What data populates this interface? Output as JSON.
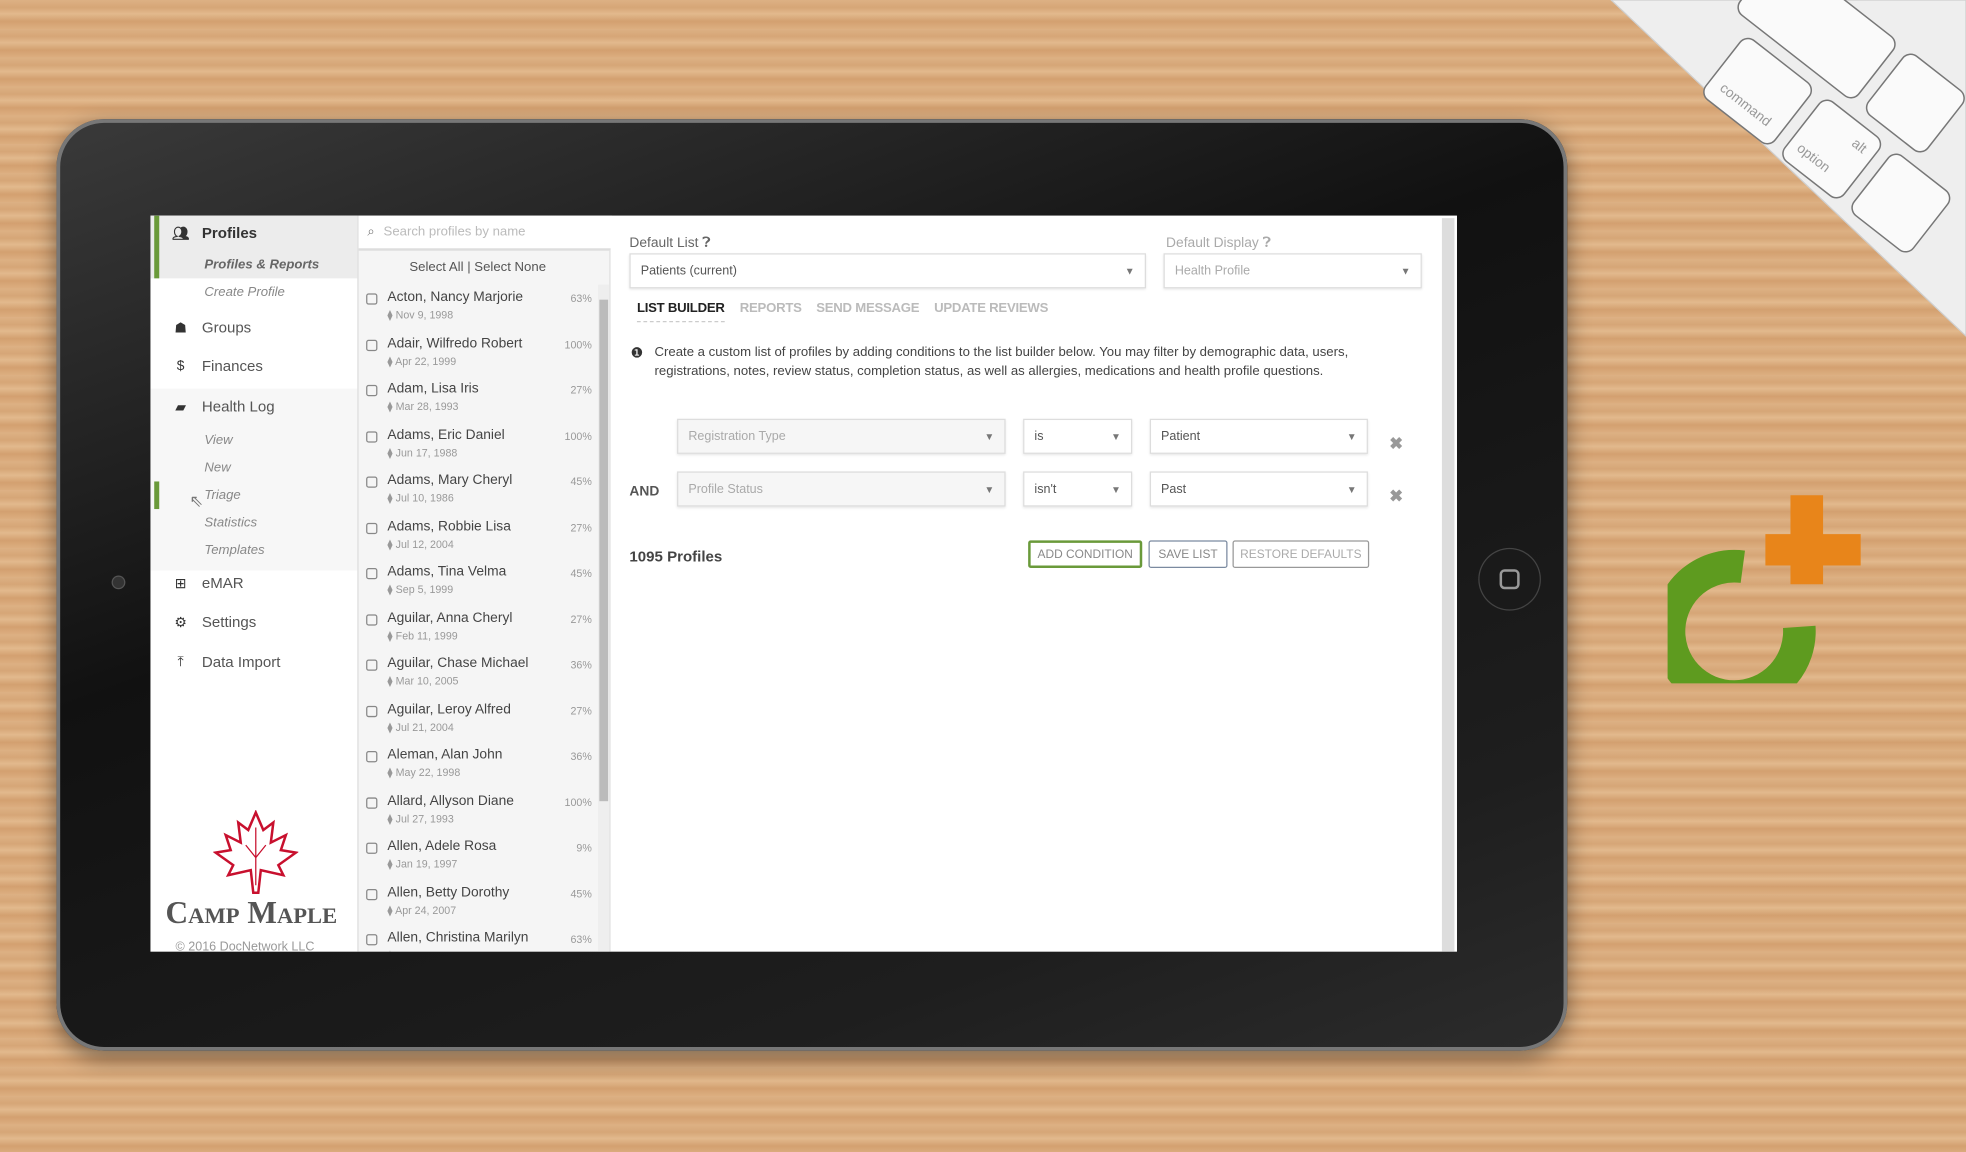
{
  "sidebar": {
    "profiles": "Profiles",
    "profiles_reports": "Profiles & Reports",
    "create_profile": "Create Profile",
    "groups": "Groups",
    "finances": "Finances",
    "health_log": "Health Log",
    "hl_sub": [
      "View",
      "New",
      "Triage",
      "Statistics",
      "Templates"
    ],
    "emar": "eMAR",
    "settings": "Settings",
    "data_import": "Data Import",
    "logo_text": "Camp Maple",
    "copyright": "© 2016 DocNetwork LLC"
  },
  "plist": {
    "search_placeholder": "Search profiles by name",
    "select_all": "Select All",
    "sep": "|",
    "select_none": "Select None",
    "rows": [
      {
        "name": "Acton, Nancy Marjorie",
        "dob": "Nov 9, 1998",
        "pct": "63%"
      },
      {
        "name": "Adair, Wilfredo Robert",
        "dob": "Apr 22, 1999",
        "pct": "100%"
      },
      {
        "name": "Adam, Lisa Iris",
        "dob": "Mar 28, 1993",
        "pct": "27%"
      },
      {
        "name": "Adams, Eric Daniel",
        "dob": "Jun 17, 1988",
        "pct": "100%"
      },
      {
        "name": "Adams, Mary Cheryl",
        "dob": "Jul 10, 1986",
        "pct": "45%"
      },
      {
        "name": "Adams, Robbie Lisa",
        "dob": "Jul 12, 2004",
        "pct": "27%"
      },
      {
        "name": "Adams, Tina Velma",
        "dob": "Sep 5, 1999",
        "pct": "45%"
      },
      {
        "name": "Aguilar, Anna Cheryl",
        "dob": "Feb 11, 1999",
        "pct": "27%"
      },
      {
        "name": "Aguilar, Chase Michael",
        "dob": "Mar 10, 2005",
        "pct": "36%"
      },
      {
        "name": "Aguilar, Leroy Alfred",
        "dob": "Jul 21, 2004",
        "pct": "27%"
      },
      {
        "name": "Aleman, Alan John",
        "dob": "May 22, 1998",
        "pct": "36%"
      },
      {
        "name": "Allard, Allyson Diane",
        "dob": "Jul 27, 1993",
        "pct": "100%"
      },
      {
        "name": "Allen, Adele Rosa",
        "dob": "Jan 19, 1997",
        "pct": "9%"
      },
      {
        "name": "Allen, Betty Dorothy",
        "dob": "Apr 24, 2007",
        "pct": "45%"
      },
      {
        "name": "Allen, Christina Marilyn",
        "dob": "",
        "pct": "63%"
      }
    ]
  },
  "main": {
    "default_list_label": "Default List",
    "default_list_value": "Patients (current)",
    "default_display_label": "Default Display",
    "default_display_value": "Health Profile",
    "tabs": [
      "LIST BUILDER",
      "REPORTS",
      "SEND MESSAGE",
      "UPDATE REVIEWS"
    ],
    "info": "Create a custom list of profiles by adding conditions to the list builder below. You may filter by demographic data, users, registrations, notes, review status, completion status, as well as allergies, medications and health profile questions.",
    "conditions": [
      {
        "join": "",
        "field": "Registration Type",
        "op": "is",
        "value": "Patient"
      },
      {
        "join": "AND",
        "field": "Profile Status",
        "op": "isn't",
        "value": "Past"
      }
    ],
    "count": "1095 Profiles",
    "add_condition": "ADD CONDITION",
    "save_list": "SAVE LIST",
    "restore_defaults": "RESTORE DEFAULTS"
  },
  "keyboard": {
    "keys": [
      "command",
      "option",
      "alt"
    ]
  },
  "colors": {
    "accent_green": "#6a9a3a",
    "logo_green": "#5e9b1f",
    "logo_orange": "#e8851a",
    "maple_red": "#c8102e"
  }
}
